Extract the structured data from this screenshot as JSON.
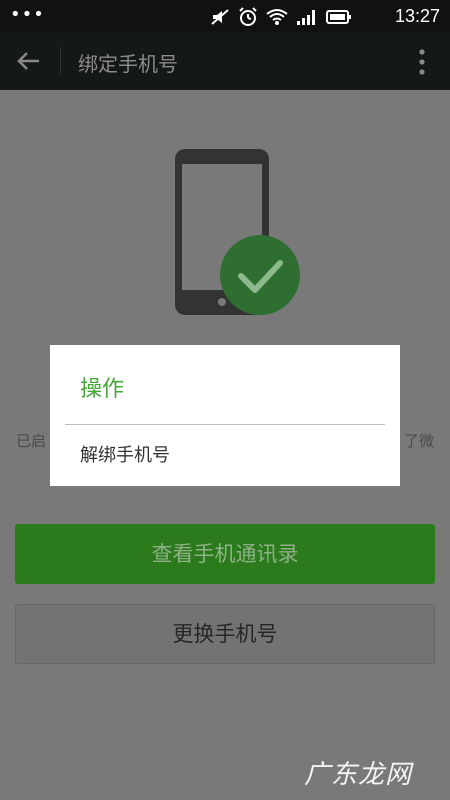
{
  "status_bar": {
    "dots": "•••",
    "time": "13:27"
  },
  "toolbar": {
    "title": "绑定手机号"
  },
  "info": {
    "left_fragment": "已启",
    "right_fragment": "了微"
  },
  "buttons": {
    "view_contacts": "查看手机通讯录",
    "change_number": "更换手机号"
  },
  "dialog": {
    "title": "操作",
    "items": [
      "解绑手机号"
    ]
  },
  "watermark": "广东龙网",
  "colors": {
    "accent_green": "#46a63a",
    "button_green": "#2b7a1c",
    "badge_green": "#2e6e31"
  }
}
